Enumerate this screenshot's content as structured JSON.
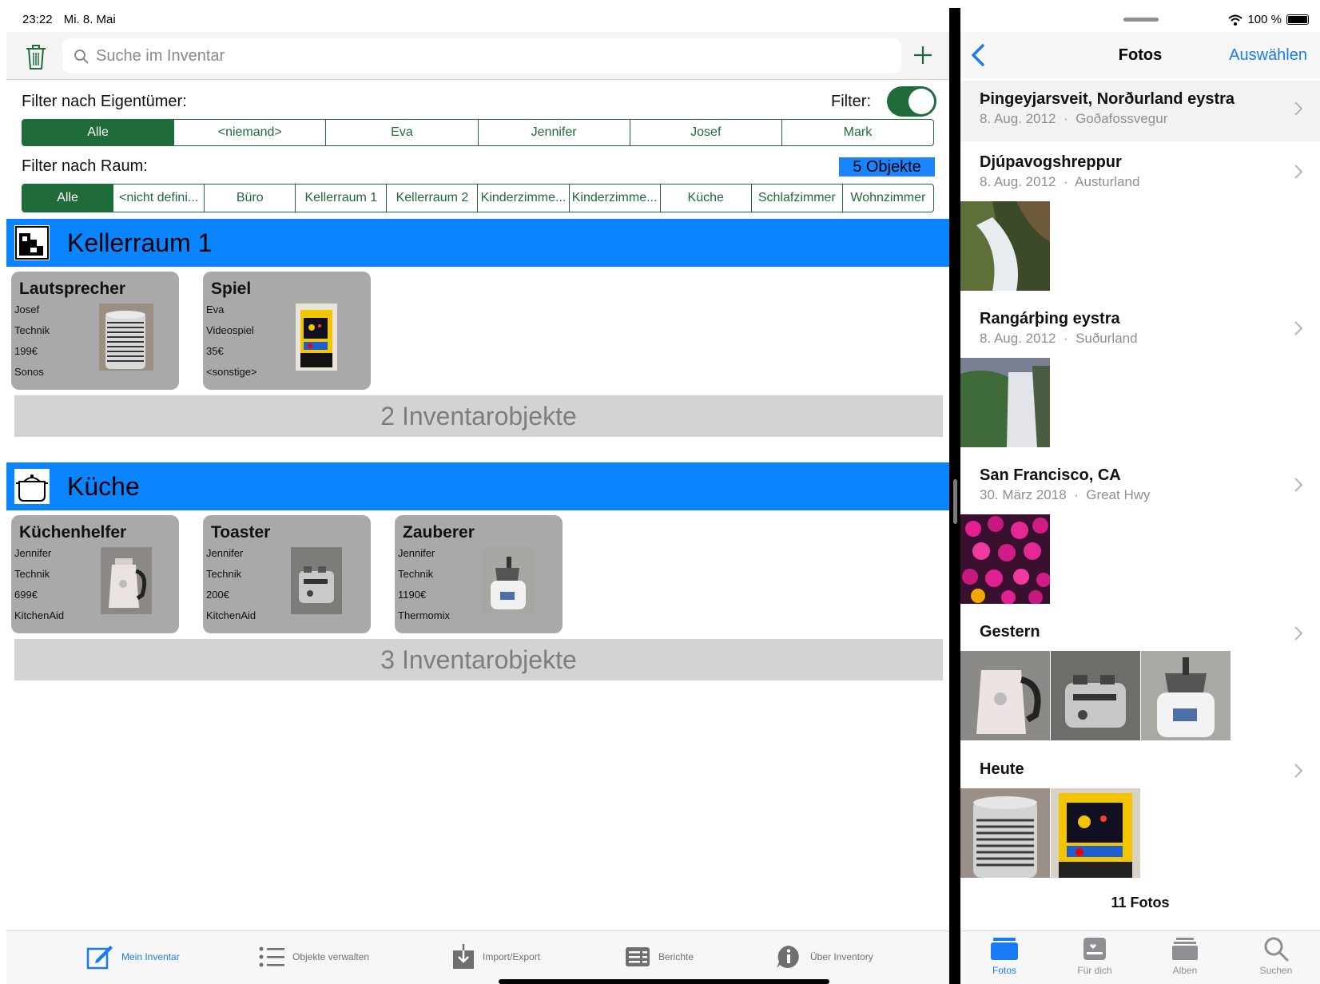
{
  "status_left": {
    "time": "23:22",
    "date": "Mi. 8. Mai"
  },
  "status_right": {
    "battery": "100 %"
  },
  "left_app": {
    "search_placeholder": "Suche im Inventar",
    "owner_filter_label": "Filter nach Eigentümer:",
    "filter_toggle_label": "Filter:",
    "filter_on": true,
    "owners": [
      "Alle",
      "<niemand>",
      "Eva",
      "Jennifer",
      "Josef",
      "Mark"
    ],
    "room_filter_label": "Filter nach Raum:",
    "object_count": "5 Objekte",
    "rooms": [
      "Alle",
      "<nicht defini...",
      "Büro",
      "Kellerraum 1",
      "Kellerraum 2",
      "Kinderzimme...",
      "Kinderzimme...",
      "Küche",
      "Schlafzimmer",
      "Wohnzimmer"
    ],
    "sections": [
      {
        "title": "Kellerraum 1",
        "items": [
          {
            "name": "Lautsprecher",
            "owner": "Josef",
            "category": "Technik",
            "price": "199€",
            "brand": "Sonos"
          },
          {
            "name": "Spiel",
            "owner": "Eva",
            "category": "Videospiel",
            "price": "35€",
            "brand": "<sonstige>"
          }
        ],
        "count": "2 Inventarobjekte"
      },
      {
        "title": "Küche",
        "items": [
          {
            "name": "Küchenhelfer",
            "owner": "Jennifer",
            "category": "Technik",
            "price": "699€",
            "brand": "KitchenAid"
          },
          {
            "name": "Toaster",
            "owner": "Jennifer",
            "category": "Technik",
            "price": "200€",
            "brand": "KitchenAid"
          },
          {
            "name": "Zauberer",
            "owner": "Jennifer",
            "category": "Technik",
            "price": "1190€",
            "brand": "Thermomix"
          }
        ],
        "count": "3 Inventarobjekte"
      }
    ],
    "tabs": [
      "Mein Inventar",
      "Objekte verwalten",
      "Import/Export",
      "Berichte",
      "Über Inventory"
    ],
    "accent": "#1f6b3a",
    "header_color": "#0b84ff"
  },
  "right_app": {
    "nav_title": "Fotos",
    "nav_select": "Auswählen",
    "moments": [
      {
        "title": "Þingeyjarsveit, Norðurland eystra",
        "date": "8. Aug. 2012",
        "place": "Goðafossvegur"
      },
      {
        "title": "Djúpavogshreppur",
        "date": "8. Aug. 2012",
        "place": "Austurland"
      },
      {
        "title": "Rangárþing eystra",
        "date": "8. Aug. 2012",
        "place": "Suðurland"
      },
      {
        "title": "San Francisco, CA",
        "date": "30. März 2018",
        "place": "Great Hwy"
      },
      {
        "title": "Gestern",
        "date": "",
        "place": ""
      },
      {
        "title": "Heute",
        "date": "",
        "place": ""
      }
    ],
    "dot": "·",
    "photo_count": "11 Fotos",
    "tabs": [
      "Fotos",
      "Für dich",
      "Alben",
      "Suchen"
    ],
    "accent": "#1a7cf5"
  }
}
